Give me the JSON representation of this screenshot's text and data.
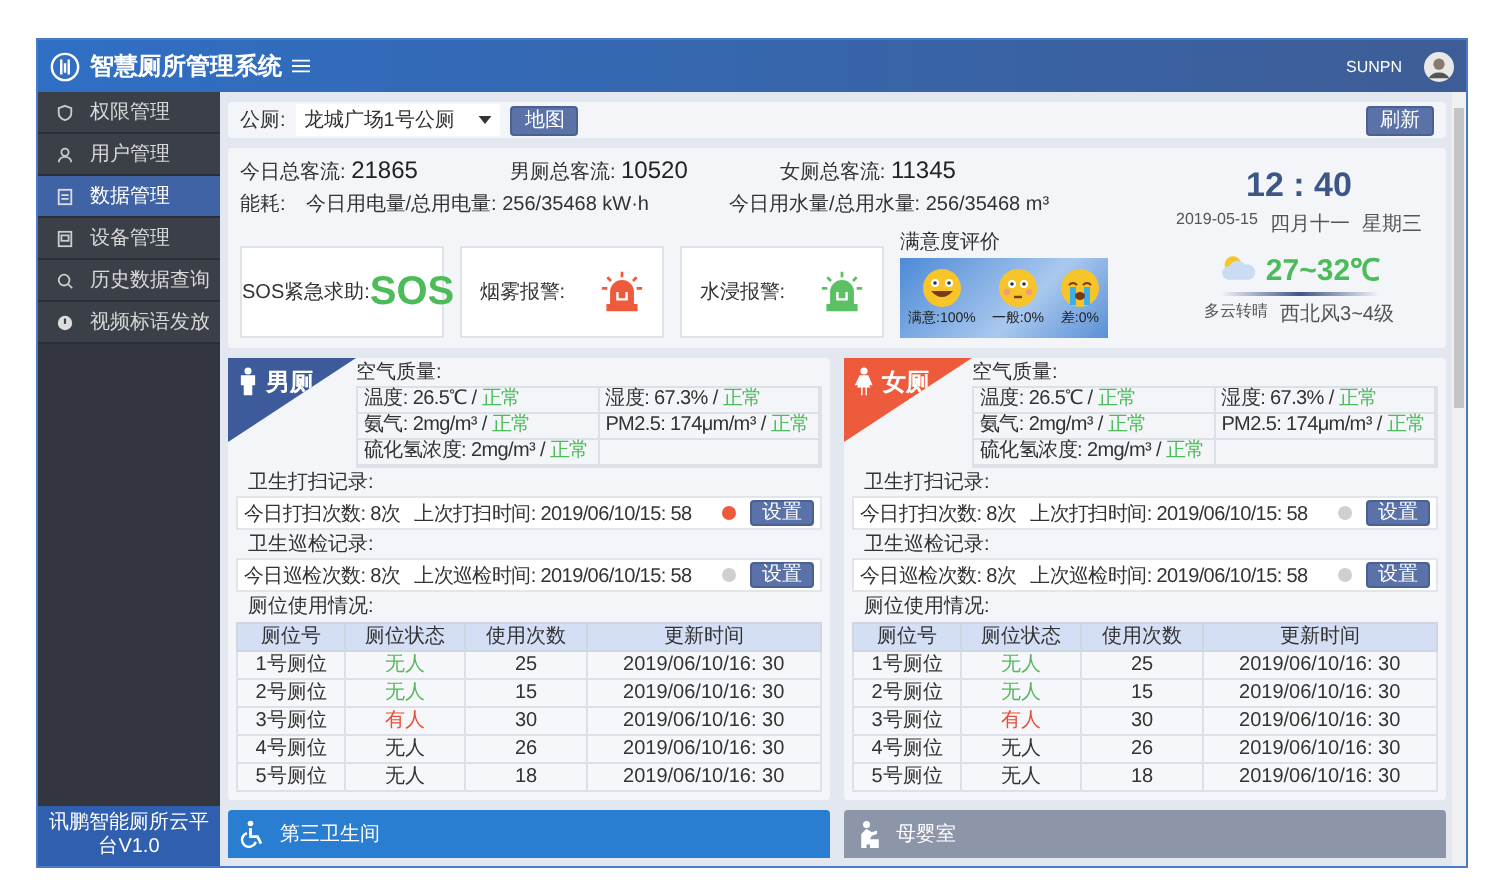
{
  "header": {
    "title": "智慧厕所管理系统",
    "user": "SUNPN"
  },
  "sidebar": {
    "items": [
      {
        "label": "权限管理",
        "selected": false
      },
      {
        "label": "用户管理",
        "selected": false
      },
      {
        "label": "数据管理",
        "selected": true
      },
      {
        "label": "设备管理",
        "selected": false
      },
      {
        "label": "历史数据查询",
        "selected": false
      },
      {
        "label": "视频标语发放",
        "selected": false
      }
    ],
    "footer": "讯鹏智能厕所云平台V1.0"
  },
  "filter": {
    "label": "公厕:",
    "value": "龙城广场1号公厕",
    "map_button": "地图",
    "refresh_button": "刷新"
  },
  "stats": {
    "counts": [
      {
        "label": "今日总客流:",
        "value": "21865"
      },
      {
        "label": "男厕总客流:",
        "value": "10520"
      },
      {
        "label": "女厕总客流:",
        "value": "11345"
      }
    ],
    "energy_label": "能耗:",
    "energy": [
      "今日用电量/总用电量: 256/35468  kW·h",
      "今日用水量/总用水量: 256/35468  m³"
    ],
    "alarms": [
      {
        "kind": "sos",
        "label": "SOS紧急求助:",
        "text": "SOS",
        "alarm": false
      },
      {
        "kind": "siren",
        "label": "烟雾报警:",
        "alarm": true
      },
      {
        "kind": "siren",
        "label": "水浸报警:",
        "alarm": false
      }
    ],
    "satisfaction": {
      "title": "满意度评价",
      "items": [
        {
          "kind": "happy",
          "label": "满意:100%"
        },
        {
          "kind": "neutral",
          "label": "一般:0%"
        },
        {
          "kind": "crying",
          "label": "差:0%"
        }
      ]
    },
    "clock": {
      "time": "12 : 40",
      "date": "2019-05-15",
      "lunar": "四月十一",
      "weekday": "星期三"
    },
    "weather": {
      "temp": "27~32℃",
      "desc": "多云转晴",
      "wind": "西北风3~4级"
    }
  },
  "rooms": [
    {
      "kind": "male",
      "name": "男厕",
      "air_title": "空气质量:",
      "air": [
        {
          "text": "温度: 26.5℃ /",
          "status": "正常"
        },
        {
          "text": "湿度: 67.3% /",
          "status": "正常"
        },
        {
          "text": "氨气: 2mg/m³ /",
          "status": "正常"
        },
        {
          "text": "PM2.5: 174μm/m³ /",
          "status": "正常"
        },
        {
          "text": "硫化氢浓度: 2mg/m³ /",
          "status": "正常"
        }
      ],
      "records": [
        {
          "title": "卫生打扫记录:",
          "count": "今日打扫次数: 8次",
          "last": "上次打扫时间: 2019/06/10/15: 58",
          "alert": true,
          "button": "设置"
        },
        {
          "title": "卫生巡检记录:",
          "count": "今日巡检次数: 8次",
          "last": "上次巡检时间: 2019/06/10/15: 58",
          "alert": false,
          "button": "设置"
        }
      ],
      "usage_title": "厕位使用情况:",
      "columns": [
        "厕位号",
        "厕位状态",
        "使用次数",
        "更新时间"
      ],
      "rows": [
        {
          "stall": "1号厕位",
          "status": "无人",
          "color": "#58b85c",
          "uses": "25",
          "time": "2019/06/10/16: 30"
        },
        {
          "stall": "2号厕位",
          "status": "无人",
          "color": "#58b85c",
          "uses": "15",
          "time": "2019/06/10/16: 30"
        },
        {
          "stall": "3号厕位",
          "status": "有人",
          "color": "#e8503a",
          "uses": "30",
          "time": "2019/06/10/16: 30"
        },
        {
          "stall": "4号厕位",
          "status": "无人",
          "color": "#333333",
          "uses": "26",
          "time": "2019/06/10/16: 30"
        },
        {
          "stall": "5号厕位",
          "status": "无人",
          "color": "#333333",
          "uses": "18",
          "time": "2019/06/10/16: 30"
        }
      ]
    },
    {
      "kind": "female",
      "name": "女厕",
      "air_title": "空气质量:",
      "air": [
        {
          "text": "温度: 26.5℃ /",
          "status": "正常"
        },
        {
          "text": "湿度: 67.3% /",
          "status": "正常"
        },
        {
          "text": "氨气: 2mg/m³ /",
          "status": "正常"
        },
        {
          "text": "PM2.5: 174μm/m³ /",
          "status": "正常"
        },
        {
          "text": "硫化氢浓度: 2mg/m³ /",
          "status": "正常"
        }
      ],
      "records": [
        {
          "title": "卫生打扫记录:",
          "count": "今日打扫次数: 8次",
          "last": "上次打扫时间: 2019/06/10/15: 58",
          "alert": false,
          "button": "设置"
        },
        {
          "title": "卫生巡检记录:",
          "count": "今日巡检次数: 8次",
          "last": "上次巡检时间: 2019/06/10/15: 58",
          "alert": false,
          "button": "设置"
        }
      ],
      "usage_title": "厕位使用情况:",
      "columns": [
        "厕位号",
        "厕位状态",
        "使用次数",
        "更新时间"
      ],
      "rows": [
        {
          "stall": "1号厕位",
          "status": "无人",
          "color": "#58b85c",
          "uses": "25",
          "time": "2019/06/10/16: 30"
        },
        {
          "stall": "2号厕位",
          "status": "无人",
          "color": "#58b85c",
          "uses": "15",
          "time": "2019/06/10/16: 30"
        },
        {
          "stall": "3号厕位",
          "status": "有人",
          "color": "#e8503a",
          "uses": "30",
          "time": "2019/06/10/16: 30"
        },
        {
          "stall": "4号厕位",
          "status": "无人",
          "color": "#333333",
          "uses": "26",
          "time": "2019/06/10/16: 30"
        },
        {
          "stall": "5号厕位",
          "status": "无人",
          "color": "#333333",
          "uses": "18",
          "time": "2019/06/10/16: 30"
        }
      ]
    }
  ],
  "extra_rooms": [
    {
      "kind": "accessible",
      "name": "第三卫生间"
    },
    {
      "kind": "nursing",
      "name": "母婴室"
    }
  ]
}
